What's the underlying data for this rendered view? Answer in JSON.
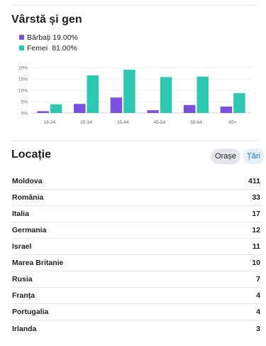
{
  "age_gender": {
    "title": "Vârstă și gen",
    "legend": [
      {
        "label": "Bărbați",
        "value": "19.00%",
        "color": "#7b4fe0"
      },
      {
        "label": "Femei",
        "value": "81.00%",
        "color": "#2ec7b1"
      }
    ]
  },
  "chart_data": {
    "type": "bar",
    "categories": [
      "18-24",
      "25-34",
      "35-44",
      "45-54",
      "55-64",
      "65+"
    ],
    "series": [
      {
        "name": "Bărbați",
        "color": "#7b4fe0",
        "values": [
          0.8,
          4.0,
          6.8,
          1.2,
          3.5,
          2.8
        ]
      },
      {
        "name": "Femei",
        "color": "#2ec7b1",
        "values": [
          3.8,
          16.5,
          19.0,
          15.8,
          16.0,
          8.7
        ]
      }
    ],
    "yticks": [
      "0%",
      "5%",
      "10%",
      "15%",
      "20%"
    ],
    "ylim": [
      0,
      20
    ],
    "grid": true
  },
  "location": {
    "title": "Locație",
    "cities_label": "Orașe",
    "countries_label": "Țări",
    "rows": [
      {
        "name": "Moldova",
        "count": "411"
      },
      {
        "name": "România",
        "count": "33"
      },
      {
        "name": "Italia",
        "count": "17"
      },
      {
        "name": "Germania",
        "count": "12"
      },
      {
        "name": "Israel",
        "count": "11"
      },
      {
        "name": "Marea Britanie",
        "count": "10"
      },
      {
        "name": "Rusia",
        "count": "7"
      },
      {
        "name": "Franța",
        "count": "4"
      },
      {
        "name": "Portugalia",
        "count": "4"
      },
      {
        "name": "Irlanda",
        "count": "3"
      }
    ]
  }
}
